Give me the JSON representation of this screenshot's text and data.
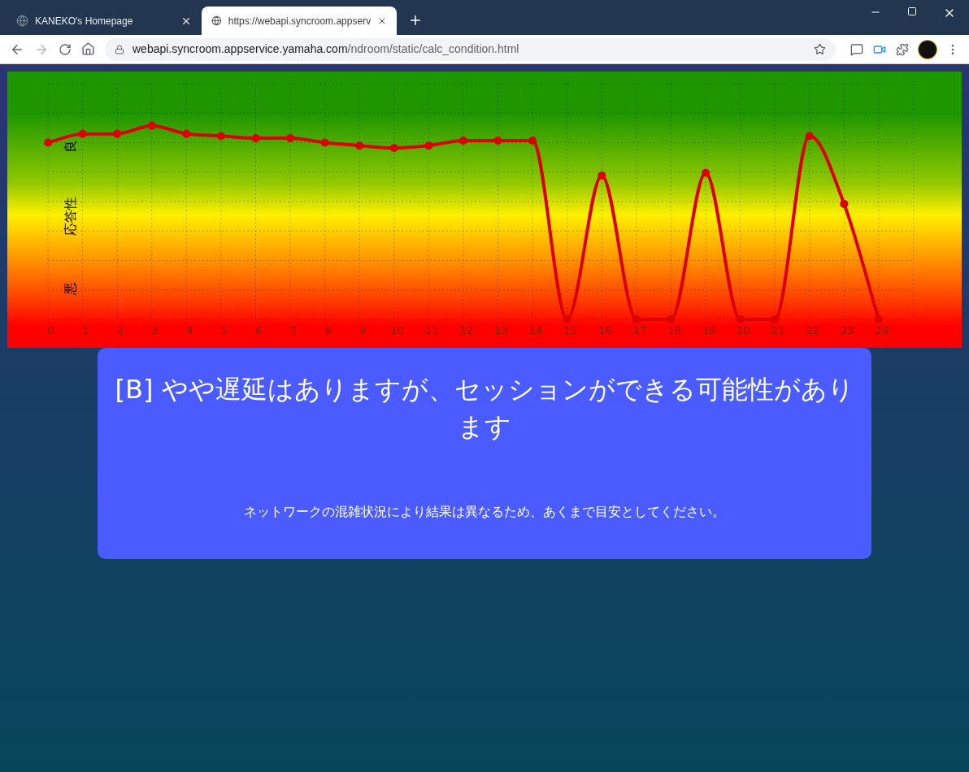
{
  "browser": {
    "tabs": [
      {
        "title": "KANEKO's Homepage",
        "selected": false
      },
      {
        "title": "https://webapi.syncroom.appserv",
        "selected": true
      }
    ],
    "address": {
      "host": "webapi.syncroom.appservice.yamaha.com",
      "path": "/ndroom/static/calc_condition.html"
    }
  },
  "chart": {
    "y_labels": [
      {
        "kind": "top",
        "text": "良"
      },
      {
        "kind": "middle",
        "text": "応答性"
      },
      {
        "kind": "bottom",
        "text": "悪"
      }
    ],
    "x_labels": [
      "0",
      "1",
      "2",
      "3",
      "4",
      "5",
      "6",
      "7",
      "8",
      "9",
      "10",
      "11",
      "12",
      "13",
      "14",
      "15",
      "16",
      "17",
      "18",
      "19",
      "20",
      "21",
      "22",
      "23",
      "24"
    ]
  },
  "result": {
    "headline": "[B] やや遅延はありますが、セッションができる可能性があります",
    "note": "ネットワークの混雑状況により結果は異なるため、あくまで目安としてください。"
  }
}
